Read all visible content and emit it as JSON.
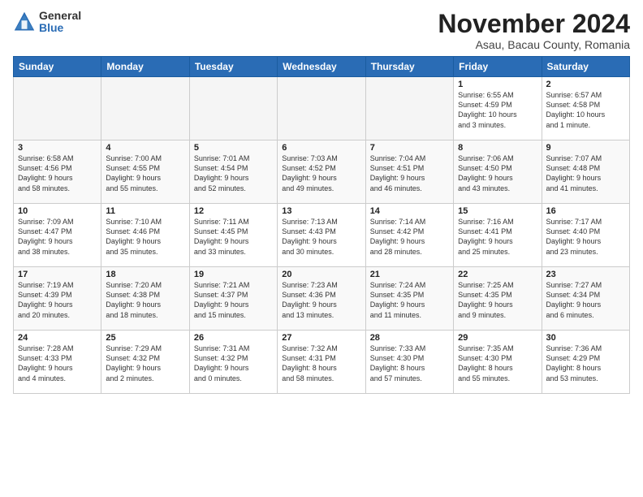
{
  "logo": {
    "general": "General",
    "blue": "Blue"
  },
  "title": "November 2024",
  "location": "Asau, Bacau County, Romania",
  "days_of_week": [
    "Sunday",
    "Monday",
    "Tuesday",
    "Wednesday",
    "Thursday",
    "Friday",
    "Saturday"
  ],
  "weeks": [
    [
      {
        "day": "",
        "info": ""
      },
      {
        "day": "",
        "info": ""
      },
      {
        "day": "",
        "info": ""
      },
      {
        "day": "",
        "info": ""
      },
      {
        "day": "",
        "info": ""
      },
      {
        "day": "1",
        "info": "Sunrise: 6:55 AM\nSunset: 4:59 PM\nDaylight: 10 hours\nand 3 minutes."
      },
      {
        "day": "2",
        "info": "Sunrise: 6:57 AM\nSunset: 4:58 PM\nDaylight: 10 hours\nand 1 minute."
      }
    ],
    [
      {
        "day": "3",
        "info": "Sunrise: 6:58 AM\nSunset: 4:56 PM\nDaylight: 9 hours\nand 58 minutes."
      },
      {
        "day": "4",
        "info": "Sunrise: 7:00 AM\nSunset: 4:55 PM\nDaylight: 9 hours\nand 55 minutes."
      },
      {
        "day": "5",
        "info": "Sunrise: 7:01 AM\nSunset: 4:54 PM\nDaylight: 9 hours\nand 52 minutes."
      },
      {
        "day": "6",
        "info": "Sunrise: 7:03 AM\nSunset: 4:52 PM\nDaylight: 9 hours\nand 49 minutes."
      },
      {
        "day": "7",
        "info": "Sunrise: 7:04 AM\nSunset: 4:51 PM\nDaylight: 9 hours\nand 46 minutes."
      },
      {
        "day": "8",
        "info": "Sunrise: 7:06 AM\nSunset: 4:50 PM\nDaylight: 9 hours\nand 43 minutes."
      },
      {
        "day": "9",
        "info": "Sunrise: 7:07 AM\nSunset: 4:48 PM\nDaylight: 9 hours\nand 41 minutes."
      }
    ],
    [
      {
        "day": "10",
        "info": "Sunrise: 7:09 AM\nSunset: 4:47 PM\nDaylight: 9 hours\nand 38 minutes."
      },
      {
        "day": "11",
        "info": "Sunrise: 7:10 AM\nSunset: 4:46 PM\nDaylight: 9 hours\nand 35 minutes."
      },
      {
        "day": "12",
        "info": "Sunrise: 7:11 AM\nSunset: 4:45 PM\nDaylight: 9 hours\nand 33 minutes."
      },
      {
        "day": "13",
        "info": "Sunrise: 7:13 AM\nSunset: 4:43 PM\nDaylight: 9 hours\nand 30 minutes."
      },
      {
        "day": "14",
        "info": "Sunrise: 7:14 AM\nSunset: 4:42 PM\nDaylight: 9 hours\nand 28 minutes."
      },
      {
        "day": "15",
        "info": "Sunrise: 7:16 AM\nSunset: 4:41 PM\nDaylight: 9 hours\nand 25 minutes."
      },
      {
        "day": "16",
        "info": "Sunrise: 7:17 AM\nSunset: 4:40 PM\nDaylight: 9 hours\nand 23 minutes."
      }
    ],
    [
      {
        "day": "17",
        "info": "Sunrise: 7:19 AM\nSunset: 4:39 PM\nDaylight: 9 hours\nand 20 minutes."
      },
      {
        "day": "18",
        "info": "Sunrise: 7:20 AM\nSunset: 4:38 PM\nDaylight: 9 hours\nand 18 minutes."
      },
      {
        "day": "19",
        "info": "Sunrise: 7:21 AM\nSunset: 4:37 PM\nDaylight: 9 hours\nand 15 minutes."
      },
      {
        "day": "20",
        "info": "Sunrise: 7:23 AM\nSunset: 4:36 PM\nDaylight: 9 hours\nand 13 minutes."
      },
      {
        "day": "21",
        "info": "Sunrise: 7:24 AM\nSunset: 4:35 PM\nDaylight: 9 hours\nand 11 minutes."
      },
      {
        "day": "22",
        "info": "Sunrise: 7:25 AM\nSunset: 4:35 PM\nDaylight: 9 hours\nand 9 minutes."
      },
      {
        "day": "23",
        "info": "Sunrise: 7:27 AM\nSunset: 4:34 PM\nDaylight: 9 hours\nand 6 minutes."
      }
    ],
    [
      {
        "day": "24",
        "info": "Sunrise: 7:28 AM\nSunset: 4:33 PM\nDaylight: 9 hours\nand 4 minutes."
      },
      {
        "day": "25",
        "info": "Sunrise: 7:29 AM\nSunset: 4:32 PM\nDaylight: 9 hours\nand 2 minutes."
      },
      {
        "day": "26",
        "info": "Sunrise: 7:31 AM\nSunset: 4:32 PM\nDaylight: 9 hours\nand 0 minutes."
      },
      {
        "day": "27",
        "info": "Sunrise: 7:32 AM\nSunset: 4:31 PM\nDaylight: 8 hours\nand 58 minutes."
      },
      {
        "day": "28",
        "info": "Sunrise: 7:33 AM\nSunset: 4:30 PM\nDaylight: 8 hours\nand 57 minutes."
      },
      {
        "day": "29",
        "info": "Sunrise: 7:35 AM\nSunset: 4:30 PM\nDaylight: 8 hours\nand 55 minutes."
      },
      {
        "day": "30",
        "info": "Sunrise: 7:36 AM\nSunset: 4:29 PM\nDaylight: 8 hours\nand 53 minutes."
      }
    ]
  ]
}
